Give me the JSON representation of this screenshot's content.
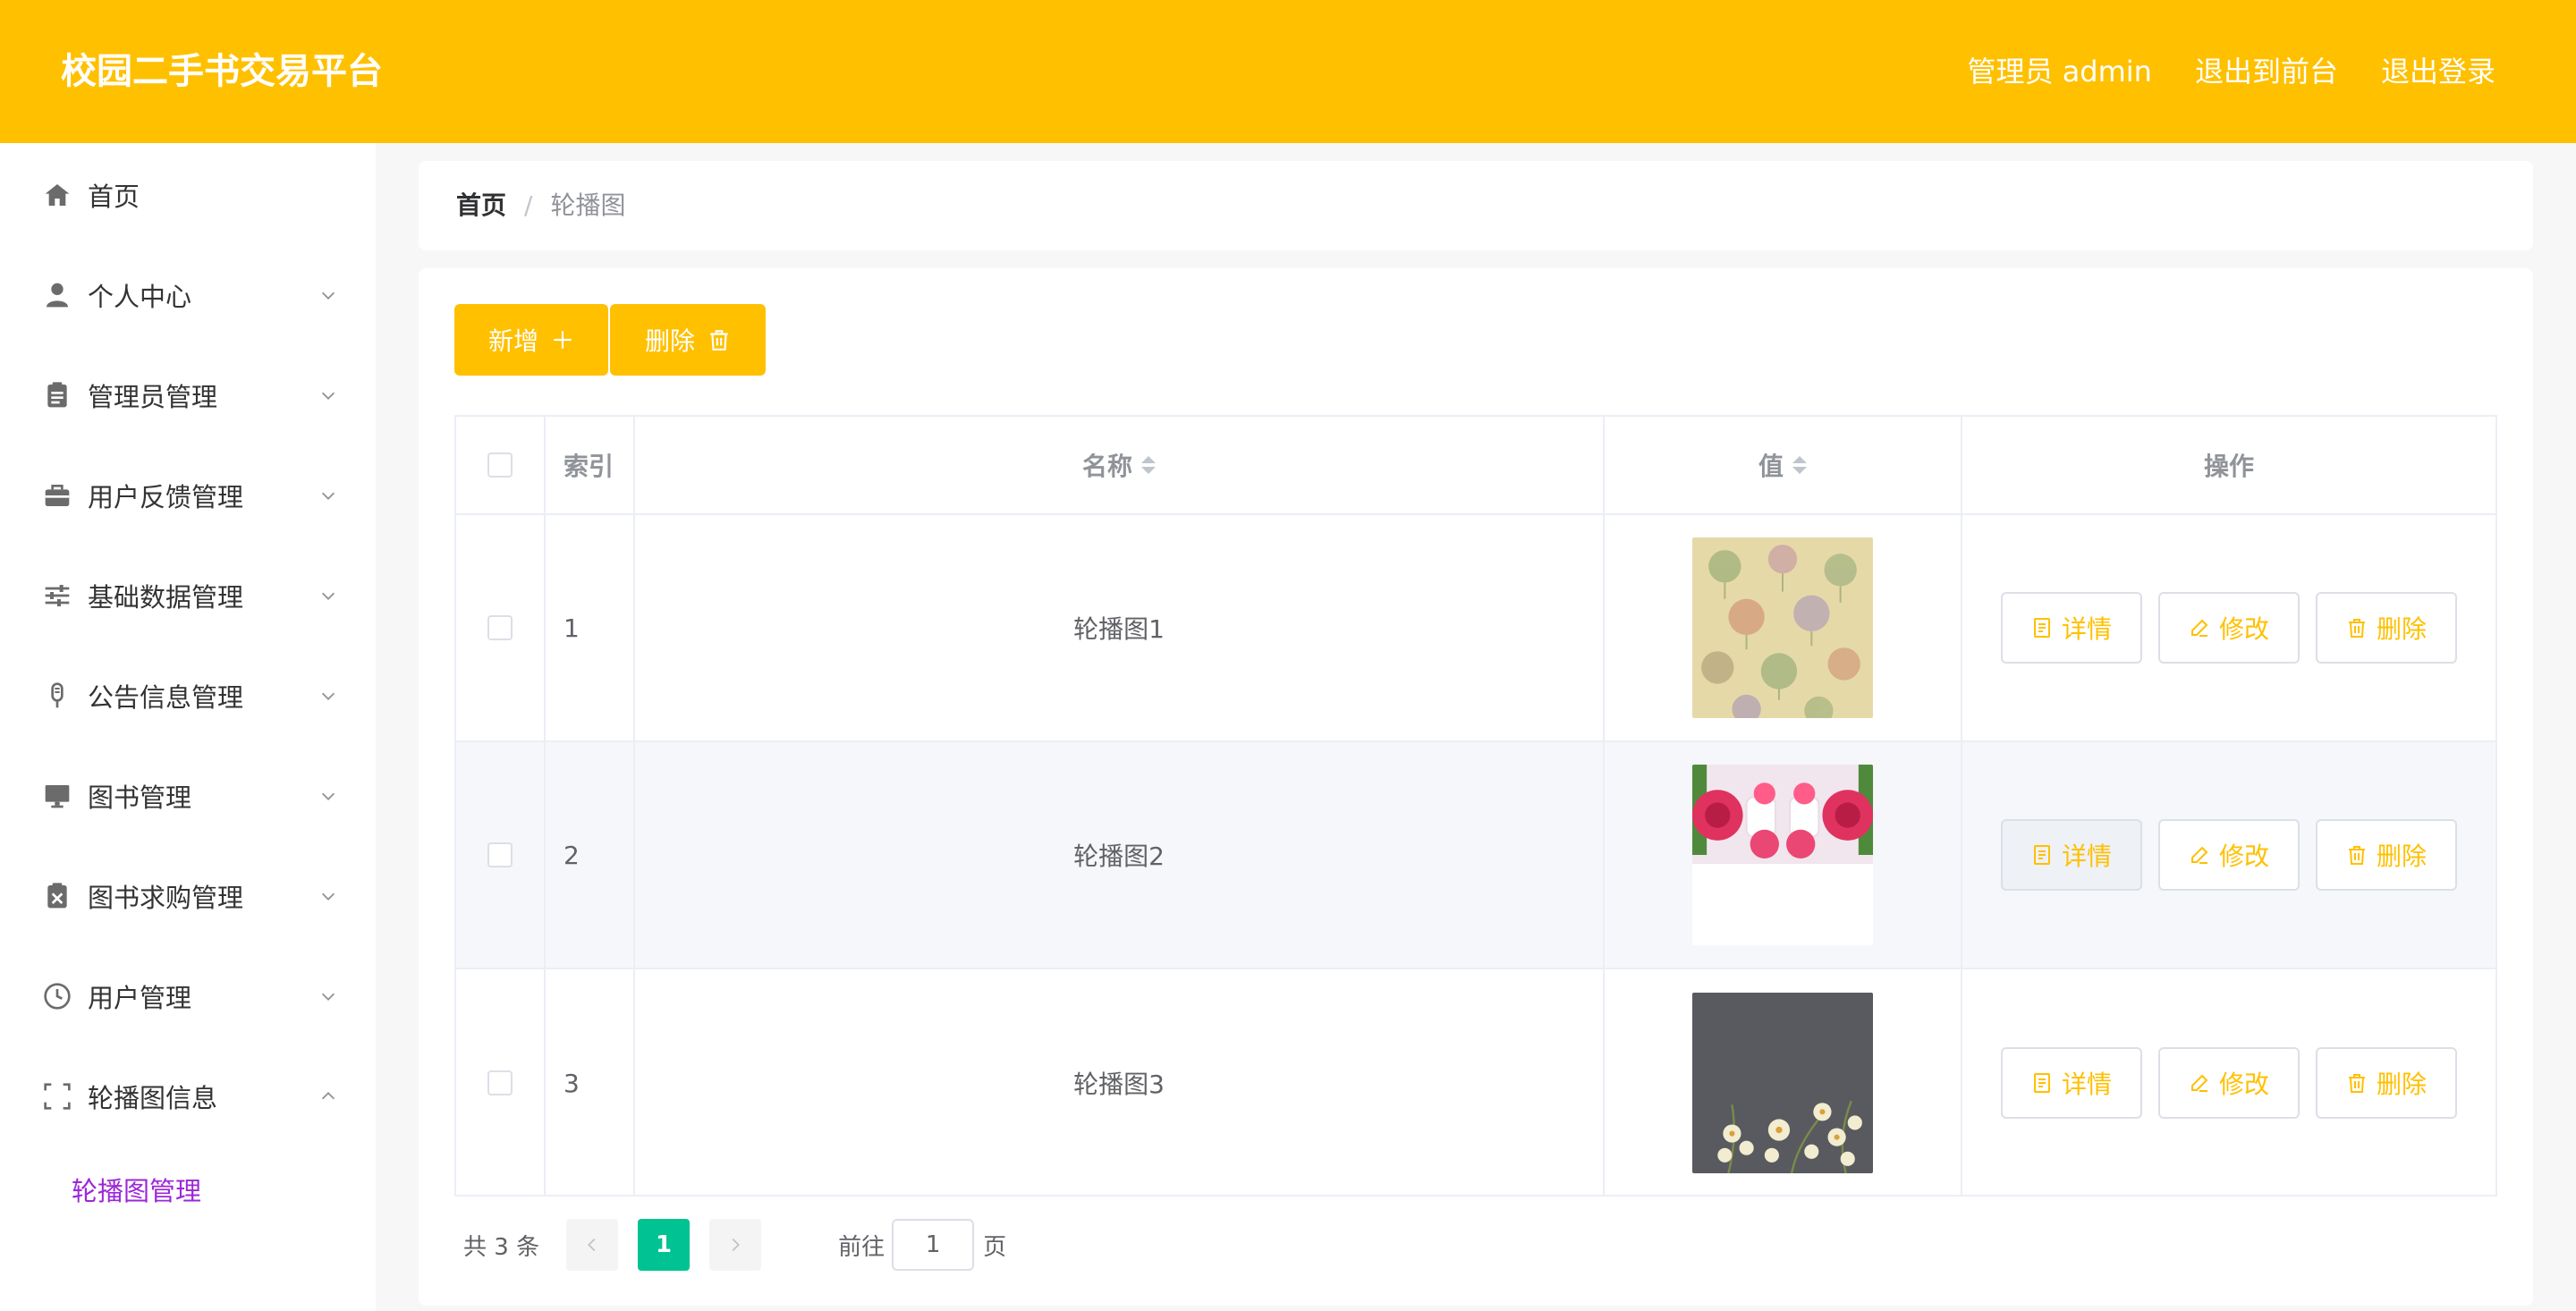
{
  "header": {
    "title": "校园二手书交易平台",
    "user": "管理员 admin",
    "exit_front": "退出到前台",
    "logout": "退出登录",
    "bg_color": "#ffc000"
  },
  "sidebar": {
    "items": [
      {
        "label": "首页",
        "icon": "home-icon"
      },
      {
        "label": "个人中心",
        "icon": "user-icon"
      },
      {
        "label": "管理员管理",
        "icon": "clipboard-icon"
      },
      {
        "label": "用户反馈管理",
        "icon": "briefcase-icon"
      },
      {
        "label": "基础数据管理",
        "icon": "sliders-icon"
      },
      {
        "label": "公告信息管理",
        "icon": "microphone-icon"
      },
      {
        "label": "图书管理",
        "icon": "monitor-icon"
      },
      {
        "label": "图书求购管理",
        "icon": "clipboard-x-icon"
      },
      {
        "label": "用户管理",
        "icon": "clock-icon"
      },
      {
        "label": "轮播图信息",
        "icon": "frame-icon"
      }
    ],
    "submenu": {
      "label": "轮播图管理",
      "color": "#9c27d8"
    }
  },
  "breadcrumb": {
    "home": "首页",
    "separator": "/",
    "current": "轮播图"
  },
  "toolbar": {
    "add_label": "新增",
    "delete_label": "删除"
  },
  "table": {
    "headers": {
      "index": "索引",
      "name": "名称",
      "value": "值",
      "actions": "操作"
    },
    "rows": [
      {
        "index": "1",
        "name": "轮播图1",
        "thumb": "floral-pattern"
      },
      {
        "index": "2",
        "name": "轮播图2",
        "thumb": "roses-gifts"
      },
      {
        "index": "3",
        "name": "轮播图3",
        "thumb": "white-flowers-dark"
      }
    ],
    "actions": {
      "detail": "详情",
      "edit": "修改",
      "delete": "删除"
    },
    "action_color": "#ffc000"
  },
  "pagination": {
    "total": "共 3 条",
    "current_page": "1",
    "goto_label": "前往",
    "goto_value": "1",
    "page_suffix": "页",
    "active_color": "#00c292"
  }
}
